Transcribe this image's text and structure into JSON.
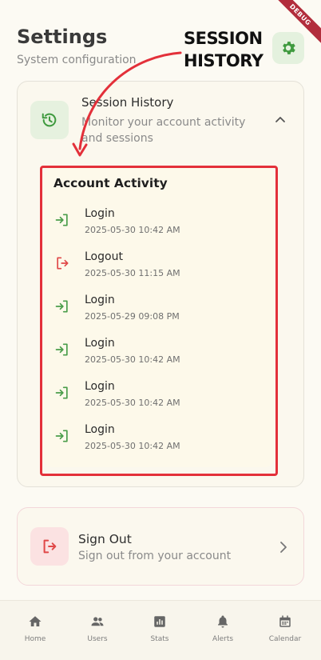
{
  "debug_banner": "DEBUG",
  "header": {
    "title": "Settings",
    "subtitle": "System configuration"
  },
  "annotation": {
    "line1": "SESSION",
    "line2": "HISTORY",
    "color": "#e3303a"
  },
  "session_card": {
    "title": "Session History",
    "description": "Monitor your account activity and sessions",
    "expanded": true
  },
  "activity": {
    "title": "Account Activity",
    "entries": [
      {
        "label": "Login",
        "timestamp": "2025-05-30 10:42 AM",
        "type": "login",
        "icon": "login-icon"
      },
      {
        "label": "Logout",
        "timestamp": "2025-05-30 11:15 AM",
        "type": "logout",
        "icon": "logout-icon"
      },
      {
        "label": "Login",
        "timestamp": "2025-05-29 09:08 PM",
        "type": "login",
        "icon": "login-icon"
      },
      {
        "label": "Login",
        "timestamp": "2025-05-30 10:42 AM",
        "type": "login",
        "icon": "login-icon"
      },
      {
        "label": "Login",
        "timestamp": "2025-05-30 10:42 AM",
        "type": "login",
        "icon": "login-icon"
      },
      {
        "label": "Login",
        "timestamp": "2025-05-30 10:42 AM",
        "type": "login",
        "icon": "login-icon"
      }
    ]
  },
  "signout": {
    "title": "Sign Out",
    "description": "Sign out from your account"
  },
  "nav": {
    "items": [
      {
        "label": "Home",
        "icon": "home-icon"
      },
      {
        "label": "Users",
        "icon": "users-icon"
      },
      {
        "label": "Stats",
        "icon": "stats-icon"
      },
      {
        "label": "Alerts",
        "icon": "bell-icon"
      },
      {
        "label": "Calendar",
        "icon": "calendar-icon"
      }
    ]
  },
  "colors": {
    "accent_green": "#4a9d4a",
    "accent_red": "#e04848",
    "background": "#fcfaf3"
  }
}
